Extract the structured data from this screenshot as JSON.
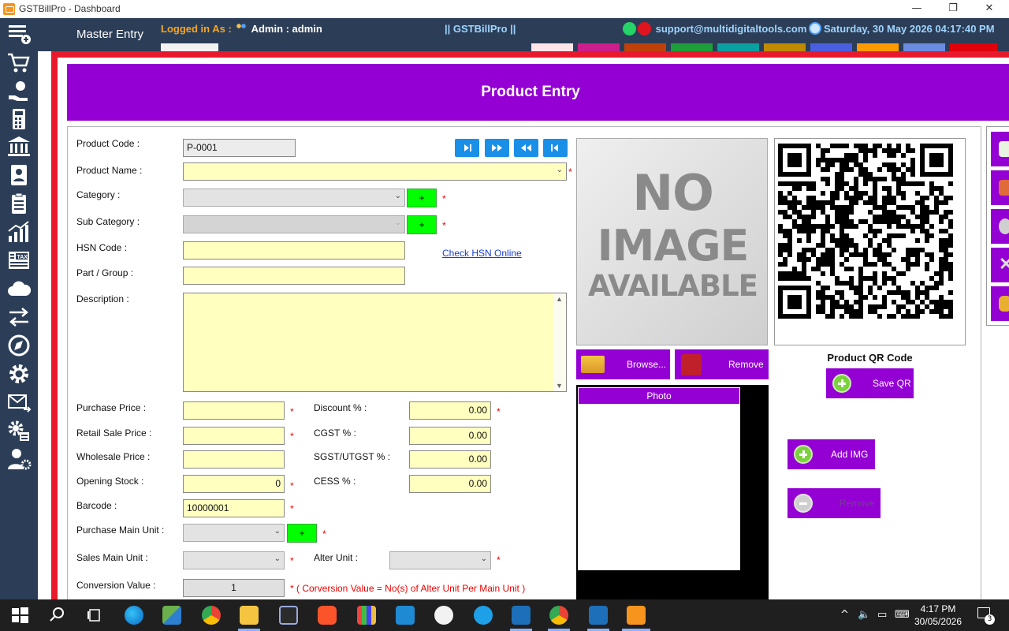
{
  "window": {
    "title": "GSTBillPro - Dashboard",
    "min_glyph": "—",
    "max_glyph": "❐",
    "close_glyph": "✕"
  },
  "header": {
    "section": "Master Entry",
    "logged_label": "Logged in As :",
    "user": "Admin  :  admin",
    "brand": "|| GSTBillPro ||",
    "support_email": "support@multidigitaltools.com",
    "datetime": "Saturday, 30 May 2026 04:17:40 PM",
    "swatch_colors": [
      "#ffe4e8",
      "#cc1e8c",
      "#c0400a",
      "#1e9e3a",
      "#0aa0a0",
      "#c08a00",
      "#4a5fe0",
      "#ff9a00",
      "#6a8be0",
      "#e0000a"
    ]
  },
  "sidebar": {
    "icons": [
      "list-add-icon",
      "cart-icon",
      "hand-money-icon",
      "calculator-icon",
      "bank-icon",
      "contact-book-icon",
      "clipboard-icon",
      "growth-chart-icon",
      "tax-icon",
      "cloud-icon",
      "transfer-arrows-icon",
      "compass-icon",
      "settings-icon",
      "mail-send-icon",
      "config-gear-icon",
      "user-settings-icon"
    ]
  },
  "page": {
    "title": "Product Entry"
  },
  "form": {
    "product_code_label": "Product Code :",
    "product_code": "P-0001",
    "product_name_label": "Product Name :",
    "category_label": "Category :",
    "sub_category_label": "Sub Category :",
    "hsn_label": "HSN Code :",
    "check_hsn": "Check HSN Online",
    "part_group_label": "Part / Group :",
    "description_label": "Description :",
    "purchase_price_label": "Purchase Price :",
    "retail_price_label": "Retail Sale Price :",
    "wholesale_price_label": "Wholesale Price :",
    "opening_stock_label": "Opening Stock :",
    "opening_stock": "0",
    "barcode_label": "Barcode :",
    "barcode": "10000001",
    "purchase_unit_label": "Purchase Main Unit :",
    "sales_unit_label": "Sales Main Unit :",
    "alter_unit_label": "Alter Unit :",
    "conversion_label": "Conversion Value :",
    "conversion_value": "1",
    "conversion_note": "* ( Corversion Value = No(s) of Alter Unit Per Main Unit )",
    "discount_label": "Discount % :",
    "discount": "0.00",
    "cgst_label": "CGST % :",
    "cgst": "0.00",
    "sgst_label": "SGST/UTGST % :",
    "sgst": "0.00",
    "cess_label": "CESS % :",
    "cess": "0.00",
    "plus": "+",
    "star": "*"
  },
  "image": {
    "no_image_l1": "NO",
    "no_image_l2": "IMAGE",
    "no_image_l3": "AVAILABLE",
    "browse": "Browse...",
    "remove": "Remove",
    "qr_caption": "Product QR Code",
    "save_qr": "Save QR",
    "photo_header": "Photo",
    "add_img": "Add IMG",
    "remove_img": "Remove"
  },
  "taskbar": {
    "time": "4:17 PM",
    "date": "30/05/2026",
    "notif_count": "3"
  }
}
